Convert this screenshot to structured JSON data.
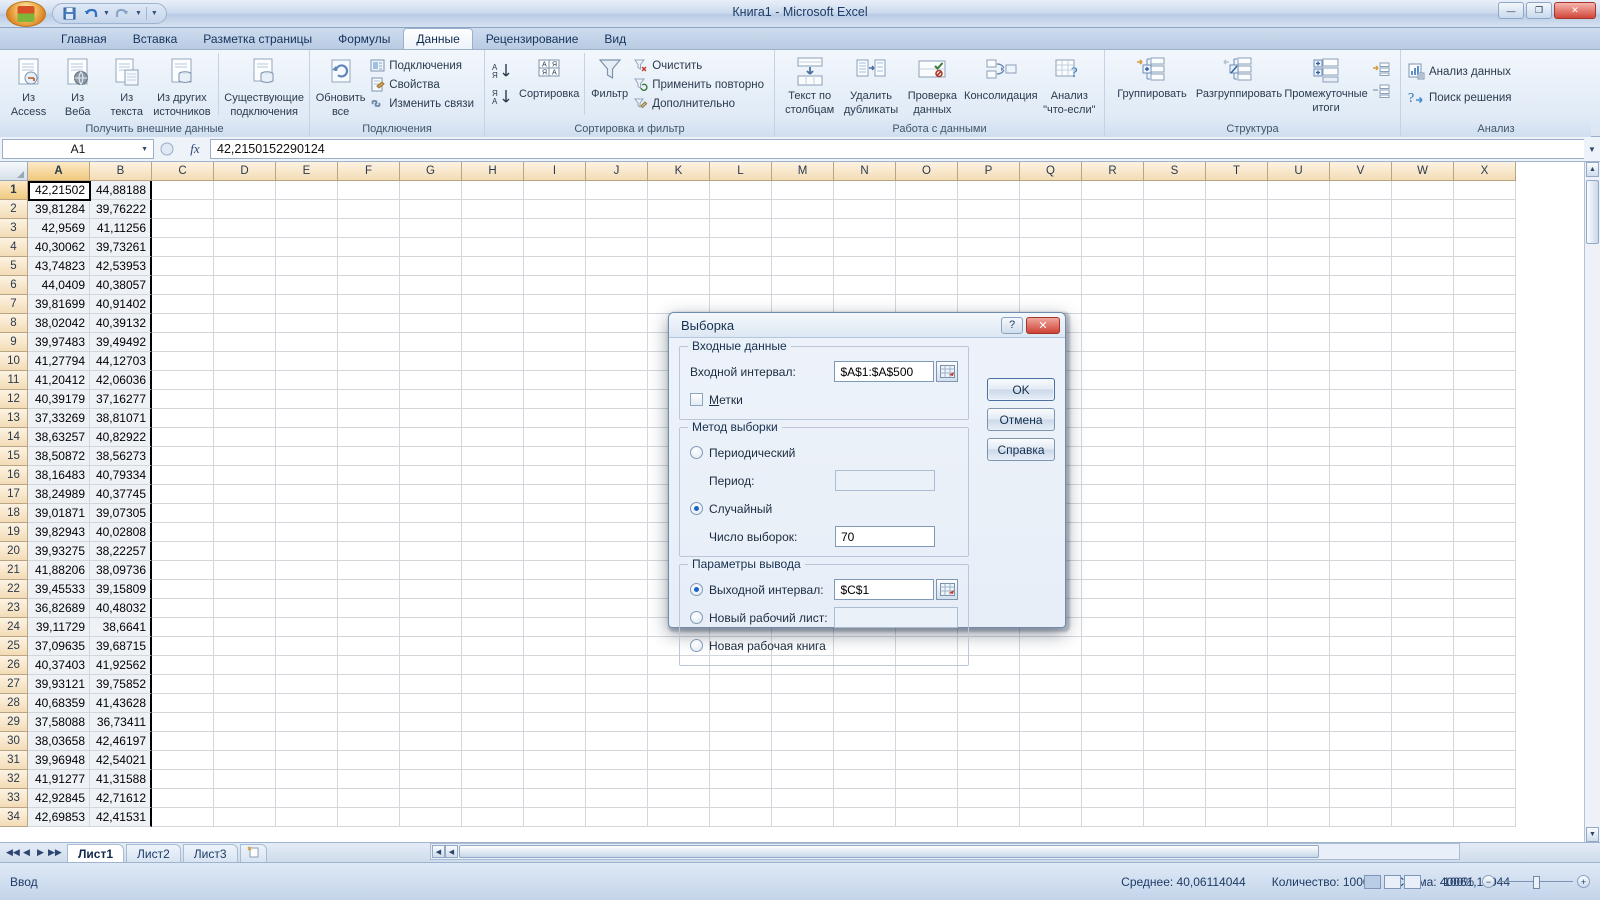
{
  "window": {
    "title": "Книга1 - Microsoft Excel",
    "minimize": "—",
    "maximize": "❐",
    "close": "✕"
  },
  "quick_access": {
    "save": "save-icon",
    "undo": "undo-icon",
    "redo": "redo-icon",
    "customize": "customize-icon"
  },
  "ribbon": {
    "tabs": [
      {
        "label": "Главная",
        "active": false
      },
      {
        "label": "Вставка",
        "active": false
      },
      {
        "label": "Разметка страницы",
        "active": false
      },
      {
        "label": "Формулы",
        "active": false
      },
      {
        "label": "Данные",
        "active": true
      },
      {
        "label": "Рецензирование",
        "active": false
      },
      {
        "label": "Вид",
        "active": false
      }
    ],
    "groups": [
      {
        "title": "Получить внешние данные",
        "big_buttons": [
          {
            "l1": "Из",
            "l2": "Access"
          },
          {
            "l1": "Из",
            "l2": "Веба"
          },
          {
            "l1": "Из",
            "l2": "текста"
          },
          {
            "l1": "Из других",
            "l2": "источников"
          },
          {
            "l1": "Существующие",
            "l2": "подключения"
          }
        ]
      },
      {
        "title": "Подключения",
        "big_buttons": [
          {
            "l1": "Обновить",
            "l2": "все"
          }
        ],
        "small_buttons": [
          "Подключения",
          "Свойства",
          "Изменить связи"
        ]
      },
      {
        "title": "Сортировка и фильтр",
        "big_buttons": [
          {
            "l1": "",
            "l2": "Сортировка"
          },
          {
            "l1": "",
            "l2": "Фильтр"
          }
        ],
        "small_buttons": [
          "Очистить",
          "Применить повторно",
          "Дополнительно"
        ]
      },
      {
        "title": "Работа с данными",
        "big_buttons": [
          {
            "l1": "Текст по",
            "l2": "столбцам"
          },
          {
            "l1": "Удалить",
            "l2": "дубликаты"
          },
          {
            "l1": "Проверка",
            "l2": "данных"
          },
          {
            "l1": "Консолидация",
            "l2": ""
          },
          {
            "l1": "Анализ",
            "l2": "\"что-если\""
          }
        ]
      },
      {
        "title": "Структура",
        "big_buttons": [
          {
            "l1": "Группировать",
            "l2": ""
          },
          {
            "l1": "Разгруппировать",
            "l2": ""
          },
          {
            "l1": "Промежуточные",
            "l2": "итоги"
          }
        ]
      },
      {
        "title": "Анализ",
        "small_buttons": [
          "Анализ данных",
          "Поиск решения"
        ]
      }
    ]
  },
  "formula_bar": {
    "name_box": "A1",
    "fx_label": "fx",
    "value": "42,2150152290124"
  },
  "grid": {
    "columns": [
      "A",
      "B",
      "C",
      "D",
      "E",
      "F",
      "G",
      "H",
      "I",
      "J",
      "K",
      "L",
      "M",
      "N",
      "O",
      "P",
      "Q",
      "R",
      "S",
      "T",
      "U",
      "V",
      "W",
      "X"
    ],
    "selected_column": "A",
    "selected_row": 1,
    "rows": [
      {
        "n": 1,
        "A": "42,21502",
        "B": "44,88188"
      },
      {
        "n": 2,
        "A": "39,81284",
        "B": "39,76222"
      },
      {
        "n": 3,
        "A": "42,9569",
        "B": "41,11256"
      },
      {
        "n": 4,
        "A": "40,30062",
        "B": "39,73261"
      },
      {
        "n": 5,
        "A": "43,74823",
        "B": "42,53953"
      },
      {
        "n": 6,
        "A": "44,0409",
        "B": "40,38057"
      },
      {
        "n": 7,
        "A": "39,81699",
        "B": "40,91402"
      },
      {
        "n": 8,
        "A": "38,02042",
        "B": "40,39132"
      },
      {
        "n": 9,
        "A": "39,97483",
        "B": "39,49492"
      },
      {
        "n": 10,
        "A": "41,27794",
        "B": "44,12703"
      },
      {
        "n": 11,
        "A": "41,20412",
        "B": "42,06036"
      },
      {
        "n": 12,
        "A": "40,39179",
        "B": "37,16277"
      },
      {
        "n": 13,
        "A": "37,33269",
        "B": "38,81071"
      },
      {
        "n": 14,
        "A": "38,63257",
        "B": "40,82922"
      },
      {
        "n": 15,
        "A": "38,50872",
        "B": "38,56273"
      },
      {
        "n": 16,
        "A": "38,16483",
        "B": "40,79334"
      },
      {
        "n": 17,
        "A": "38,24989",
        "B": "40,37745"
      },
      {
        "n": 18,
        "A": "39,01871",
        "B": "39,07305"
      },
      {
        "n": 19,
        "A": "39,82943",
        "B": "40,02808"
      },
      {
        "n": 20,
        "A": "39,93275",
        "B": "38,22257"
      },
      {
        "n": 21,
        "A": "41,88206",
        "B": "38,09736"
      },
      {
        "n": 22,
        "A": "39,45533",
        "B": "39,15809"
      },
      {
        "n": 23,
        "A": "36,82689",
        "B": "40,48032"
      },
      {
        "n": 24,
        "A": "39,11729",
        "B": "38,6641"
      },
      {
        "n": 25,
        "A": "37,09635",
        "B": "39,68715"
      },
      {
        "n": 26,
        "A": "40,37403",
        "B": "41,92562"
      },
      {
        "n": 27,
        "A": "39,93121",
        "B": "39,75852"
      },
      {
        "n": 28,
        "A": "40,68359",
        "B": "41,43628"
      },
      {
        "n": 29,
        "A": "37,58088",
        "B": "36,73411"
      },
      {
        "n": 30,
        "A": "38,03658",
        "B": "42,46197"
      },
      {
        "n": 31,
        "A": "39,96948",
        "B": "42,54021"
      },
      {
        "n": 32,
        "A": "41,91277",
        "B": "41,31588"
      },
      {
        "n": 33,
        "A": "42,92845",
        "B": "42,71612"
      },
      {
        "n": 34,
        "A": "42,69853",
        "B": "42,41531"
      }
    ]
  },
  "sheet_tabs": {
    "nav_first": "◀◀",
    "nav_prev": "◀",
    "nav_next": "▶",
    "nav_last": "▶▶",
    "tabs": [
      {
        "label": "Лист1",
        "active": true
      },
      {
        "label": "Лист2",
        "active": false
      },
      {
        "label": "Лист3",
        "active": false
      }
    ],
    "new_sheet": "new-sheet-icon"
  },
  "status_bar": {
    "mode": "Ввод",
    "average": "Среднее: 40,06114044",
    "count": "Количество: 1000",
    "sum": "Сумма: 40061,14044",
    "zoom": "100%",
    "zoom_out": "−",
    "zoom_in": "+"
  },
  "dialog": {
    "title": "Выборка",
    "help_button": "?",
    "close_button": "✕",
    "input_section": {
      "legend": "Входные данные",
      "range_label": "Входной интервал:",
      "range_value": "$A$1:$A$500",
      "labels_checkbox": "Метки",
      "labels_checked": false
    },
    "method_section": {
      "legend": "Метод выборки",
      "periodic_radio": "Периодический",
      "periodic_selected": false,
      "period_label": "Период:",
      "period_value": "",
      "random_radio": "Случайный",
      "random_selected": true,
      "count_label": "Число выборок:",
      "count_value": "70"
    },
    "output_section": {
      "legend": "Параметры вывода",
      "output_range_radio": "Выходной интервал:",
      "output_range_selected": true,
      "output_range_value": "$C$1",
      "new_sheet_radio": "Новый рабочий лист:",
      "new_sheet_selected": false,
      "new_sheet_value": "",
      "new_book_radio": "Новая рабочая книга",
      "new_book_selected": false
    },
    "buttons": {
      "ok": "OK",
      "cancel": "Отмена",
      "help": "Справка"
    }
  },
  "colors": {
    "accent": "#1c64c8",
    "header_orange": "#f3dcb6",
    "close_red": "#cf4134"
  }
}
